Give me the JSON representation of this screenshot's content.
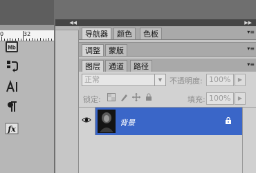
{
  "canvas": {
    "ruler_labels": [
      "0",
      "32"
    ]
  },
  "dock": {
    "collapse_glyph": "◀◀",
    "tools": [
      {
        "name": "mini-bridge-icon",
        "glyph": "Mb"
      },
      {
        "name": "history-icon",
        "glyph": "⇅"
      },
      {
        "name": "character-icon",
        "glyph": "A|"
      },
      {
        "name": "paragraph-icon",
        "glyph": "¶"
      },
      {
        "name": "styles-icon",
        "glyph": "fx"
      }
    ]
  },
  "panels": {
    "collapse_glyph": "▶▶",
    "menu_glyph": "▾≡",
    "group1": {
      "tabs": [
        "导航器",
        "颜色",
        "色板"
      ],
      "active": 0
    },
    "group2": {
      "tabs": [
        "调整",
        "蒙版"
      ],
      "active": 0
    },
    "group3": {
      "tabs": [
        "图层",
        "通道",
        "路径"
      ],
      "active": 0
    }
  },
  "layers": {
    "blend_mode": "正常",
    "opacity_label": "不透明度:",
    "opacity_value": "100%",
    "lock_label": "锁定:",
    "fill_label": "填充:",
    "fill_value": "100%",
    "items": [
      {
        "name": "背景",
        "visible": true,
        "locked": true,
        "selected": true
      }
    ]
  },
  "colors": {
    "selection": "#3a66c8",
    "panel_bg": "#d2d2d2",
    "tab_bar": "#a9a9a9"
  }
}
